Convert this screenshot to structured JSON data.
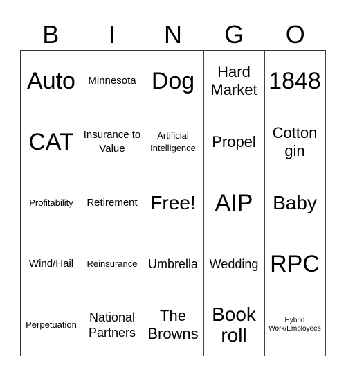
{
  "header": [
    "B",
    "I",
    "N",
    "G",
    "O"
  ],
  "cells": [
    {
      "text": "Auto",
      "size": "s-xl"
    },
    {
      "text": "Minnesota",
      "size": "s-sm"
    },
    {
      "text": "Dog",
      "size": "s-xl"
    },
    {
      "text": "Hard Market",
      "size": "s-md"
    },
    {
      "text": "1848",
      "size": "s-xl"
    },
    {
      "text": "CAT",
      "size": "s-xl"
    },
    {
      "text": "Insurance to Value",
      "size": "s-sm"
    },
    {
      "text": "Artificial Intelligence",
      "size": "s-xs"
    },
    {
      "text": "Propel",
      "size": "s-md"
    },
    {
      "text": "Cotton gin",
      "size": "s-md"
    },
    {
      "text": "Profitability",
      "size": "s-xs"
    },
    {
      "text": "Retirement",
      "size": "s-sm"
    },
    {
      "text": "Free!",
      "size": "s-lg"
    },
    {
      "text": "AIP",
      "size": "s-xl"
    },
    {
      "text": "Baby",
      "size": "s-lg"
    },
    {
      "text": "Wind/Hail",
      "size": "s-sm"
    },
    {
      "text": "Reinsurance",
      "size": "s-xs"
    },
    {
      "text": "Umbrella",
      "size": "s-ml"
    },
    {
      "text": "Wedding",
      "size": "s-ml"
    },
    {
      "text": "RPC",
      "size": "s-xl"
    },
    {
      "text": "Perpetuation",
      "size": "s-xs"
    },
    {
      "text": "National Partners",
      "size": "s-ml"
    },
    {
      "text": "The Browns",
      "size": "s-md"
    },
    {
      "text": "Book roll",
      "size": "s-lg"
    },
    {
      "text": "Hybrid Work/Employees",
      "size": "s-xxs"
    }
  ]
}
